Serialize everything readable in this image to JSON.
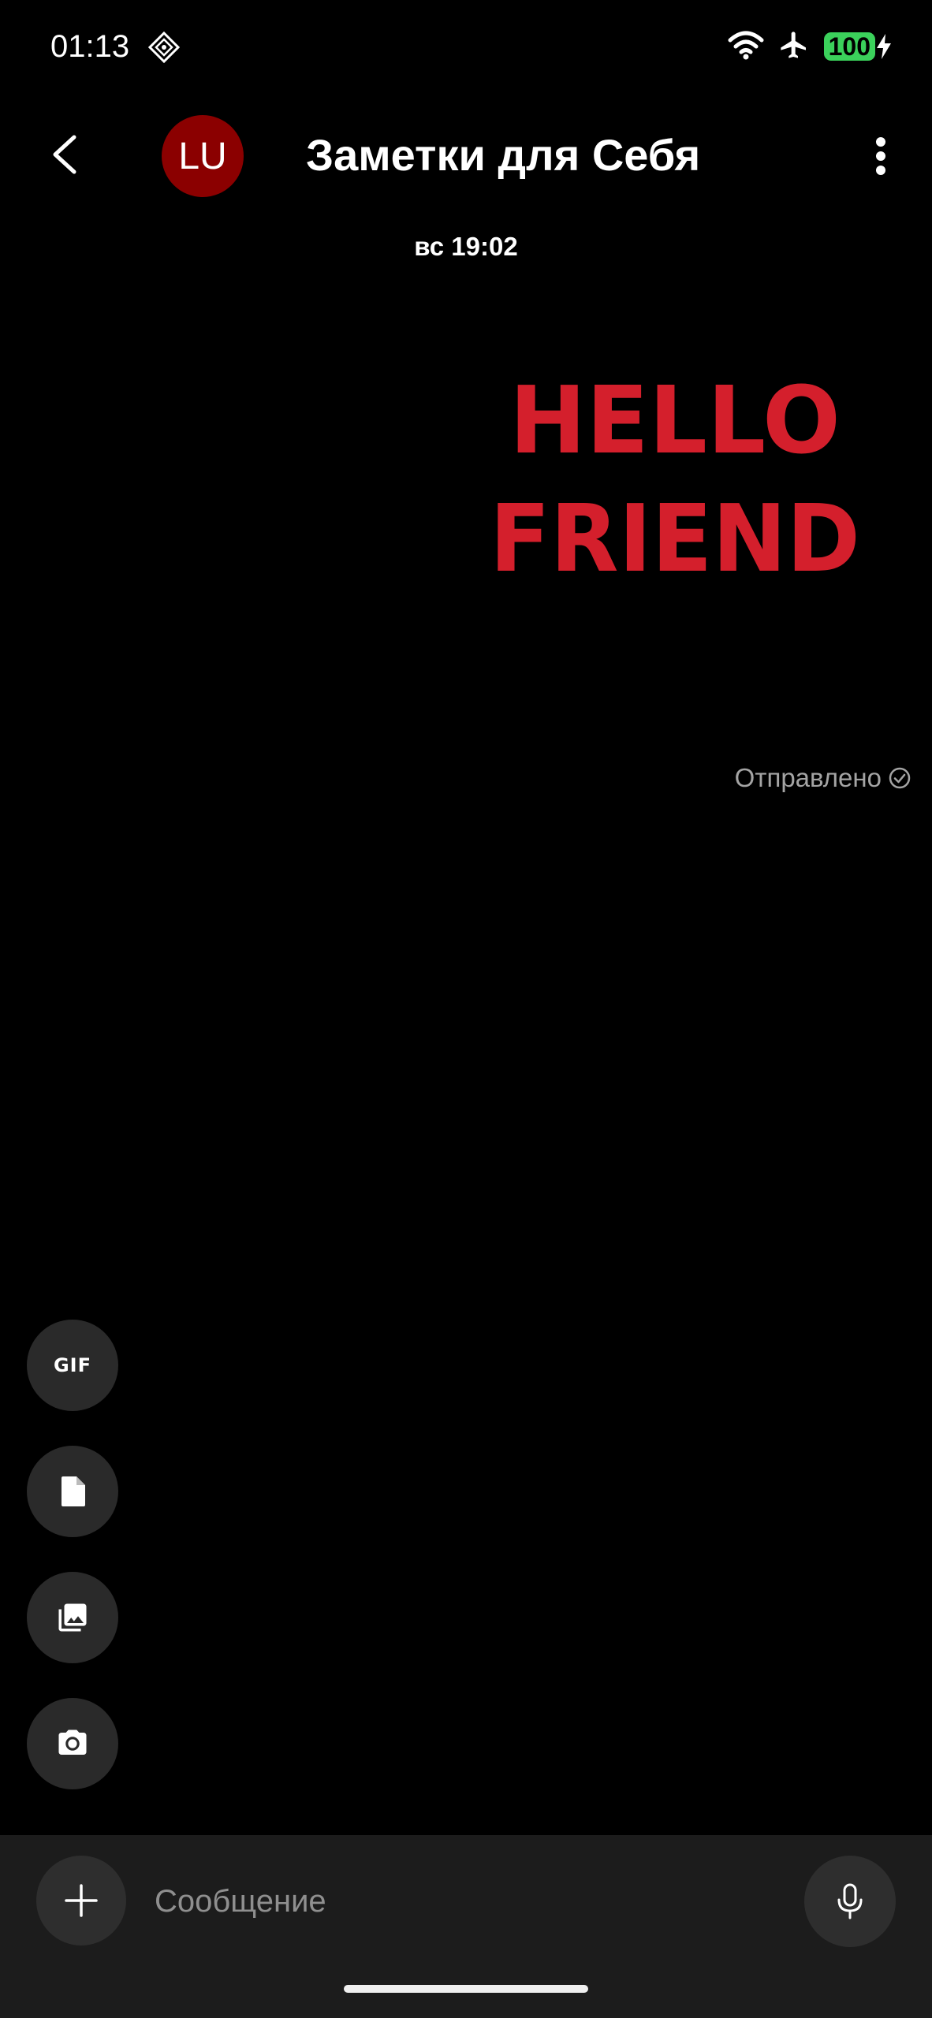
{
  "status_bar": {
    "time": "01:13",
    "battery": "100",
    "icons": [
      "app-notification-icon",
      "wifi-icon",
      "airplane-icon",
      "battery-icon",
      "charging-icon"
    ]
  },
  "header": {
    "avatar_initials": "LU",
    "avatar_color": "#8b0000",
    "title": "Заметки для Себя"
  },
  "conversation": {
    "timestamp": "вс 19:02",
    "sticker_line1": "HELLO",
    "sticker_line2": "FRIEND",
    "sticker_color": "#d41f2c",
    "status": "Отправлено"
  },
  "attach_buttons": [
    {
      "name": "gif",
      "label": "GIF"
    },
    {
      "name": "file",
      "label": ""
    },
    {
      "name": "gallery",
      "label": ""
    },
    {
      "name": "camera",
      "label": ""
    }
  ],
  "composer": {
    "placeholder": "Сообщение"
  }
}
